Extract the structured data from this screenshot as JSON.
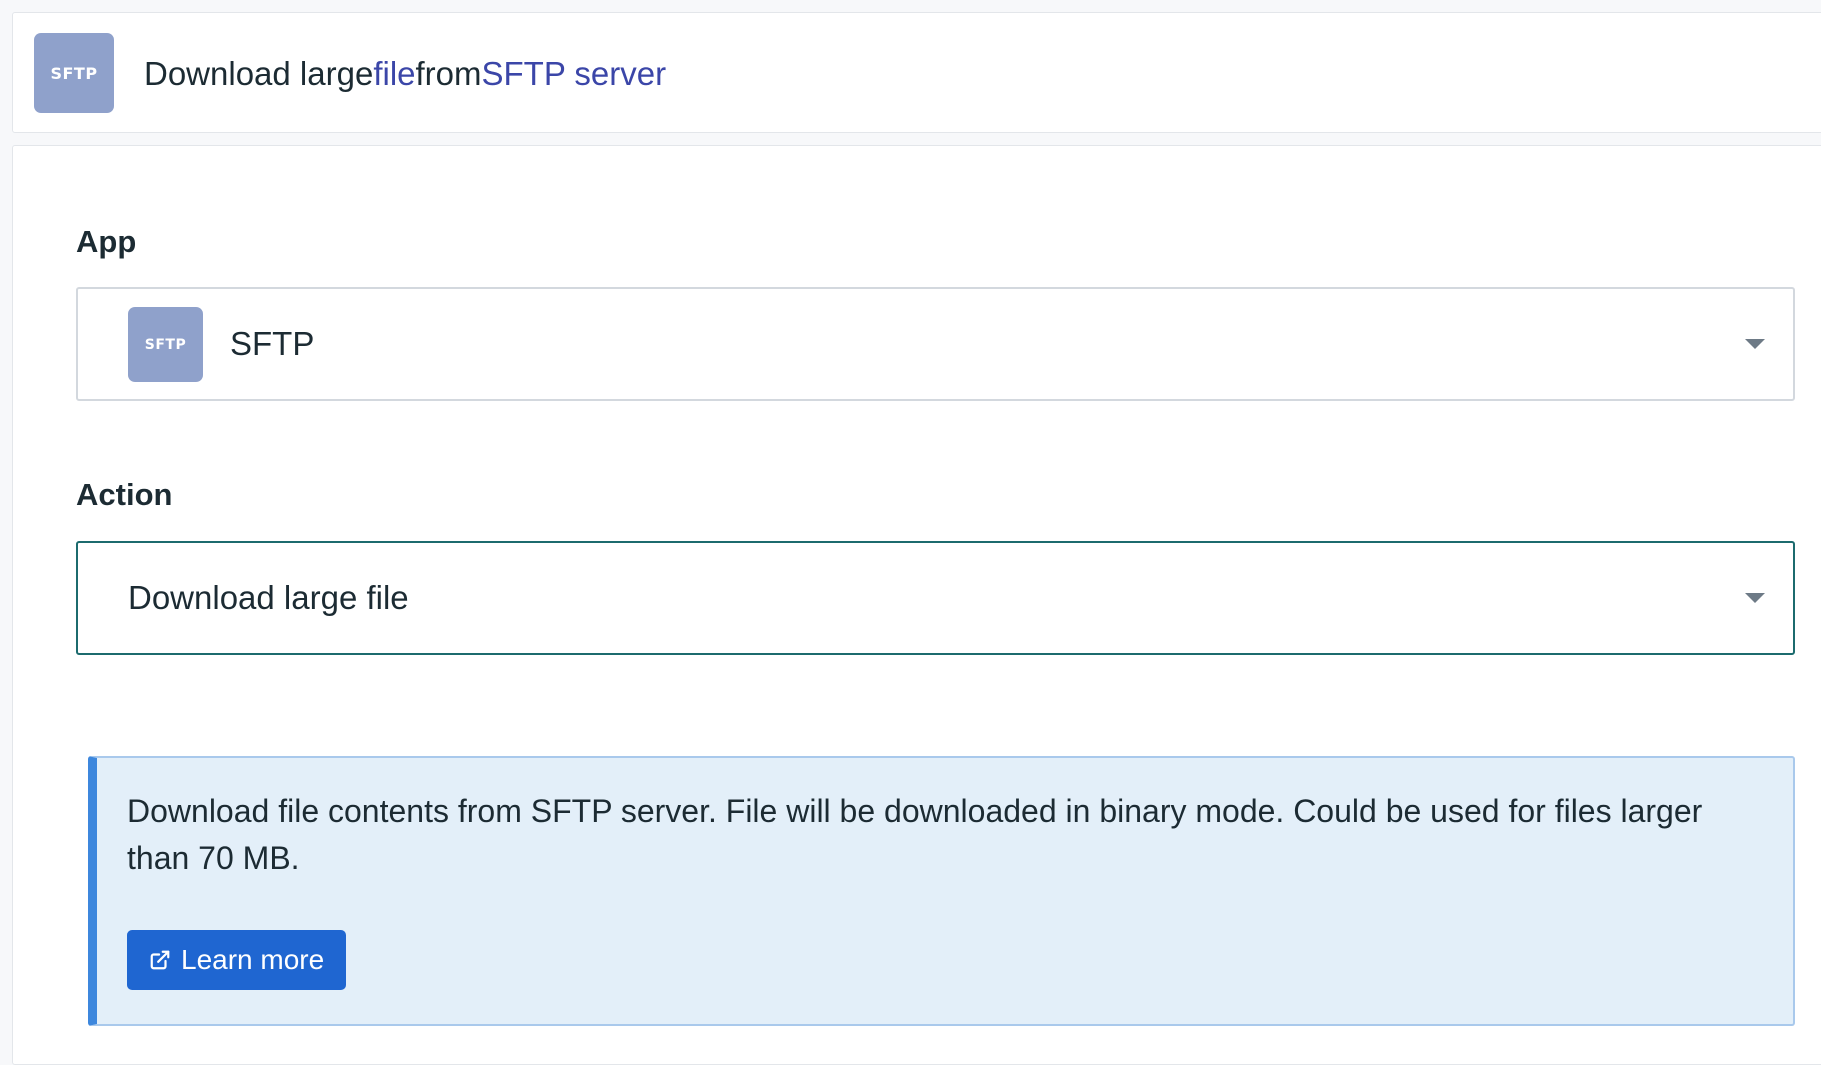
{
  "header": {
    "logo_text": "SFTP",
    "title_parts": {
      "part1": "Download large ",
      "part2": "file",
      "part3": " from ",
      "part4": "SFTP server"
    }
  },
  "form": {
    "app": {
      "label": "App",
      "logo_text": "SFTP",
      "selected": "SFTP"
    },
    "action": {
      "label": "Action",
      "selected": "Download large file"
    }
  },
  "info": {
    "description": "Download file contents from SFTP server. File will be downloaded in binary mode. Could be used for files larger than 70 MB.",
    "button_label": "Learn more",
    "button_icon": "external-link-icon"
  },
  "colors": {
    "accent": "#3b46a8",
    "logo_bg": "#8fa1cb",
    "focus_border": "#1c6b6e",
    "info_bg": "#e3eff9",
    "info_stripe": "#3d87dd",
    "button_bg": "#1f66d1"
  }
}
